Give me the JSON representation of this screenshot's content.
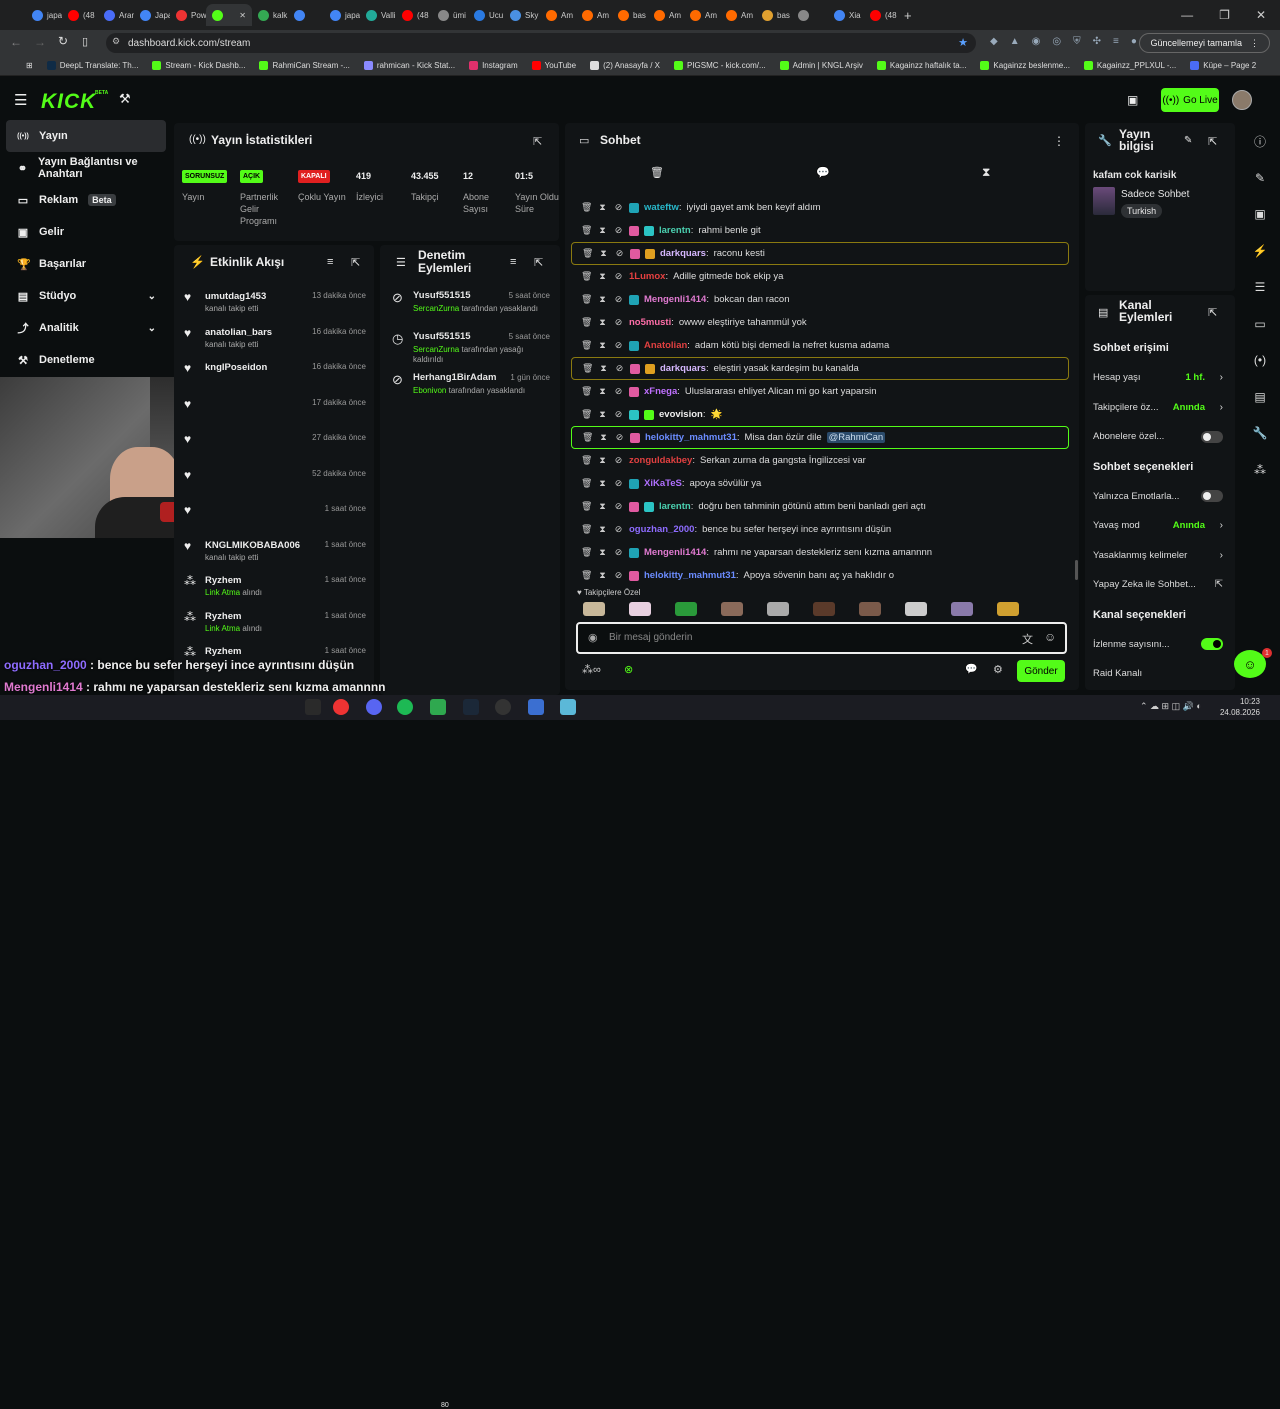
{
  "browser": {
    "tabs": [
      "japa",
      "(48",
      "Aran",
      "Japa",
      "Pow",
      "",
      "kalk",
      "",
      "japa",
      "Valli",
      "(48",
      "ümi",
      "Ucu",
      "Sky",
      "Am",
      "Am",
      "bas",
      "Am",
      "Am",
      "Am",
      "bas",
      "",
      "Xia",
      "(48"
    ],
    "url": "dashboard.kick.com/stream",
    "update_label": "Güncellemeyi tamamla",
    "bookmarks": [
      "DeepL Translate: Th...",
      "Stream - Kick Dashb...",
      "RahmiCan Stream -...",
      "rahmican - Kick Stat...",
      "Instagram",
      "YouTube",
      "(2) Anasayfa / X",
      "PIGSMC - kick.com/...",
      "Admin | KNGL Arşiv",
      "Kagainzz haftalık ta...",
      "Kagainzz beslenme...",
      "Kagainzz_PPLXUL -...",
      "Küpe – Page 2"
    ]
  },
  "nav": {
    "logo": "KICK",
    "beta": "BETA",
    "go_live": "Go Live"
  },
  "sidebar": {
    "items": [
      {
        "label": "Yayın",
        "icon": "broadcast-icon"
      },
      {
        "label": "Yayın Bağlantısı ve Anahtarı",
        "icon": "link-icon"
      },
      {
        "label": "Reklam",
        "icon": "ad-icon",
        "badge": "Beta"
      },
      {
        "label": "Gelir",
        "icon": "wallet-icon"
      },
      {
        "label": "Başarılar",
        "icon": "trophy-icon"
      },
      {
        "label": "Stüdyo",
        "icon": "studio-icon"
      },
      {
        "label": "Analitik",
        "icon": "analytics-icon"
      },
      {
        "label": "Denetleme",
        "icon": "hammer-icon"
      }
    ]
  },
  "stats": {
    "title": "Yayın İstatistikleri",
    "items": [
      {
        "value": "SORUNSUZ",
        "label": "Yayın"
      },
      {
        "value": "AÇIK",
        "label": "Partnerlik Gelir Programı"
      },
      {
        "value": "KAPALI",
        "label": "Çoklu Yayın"
      },
      {
        "value": "419",
        "label": "İzleyici"
      },
      {
        "value": "43.455",
        "label": "Takipçi"
      },
      {
        "value": "12",
        "label": "Abone Sayısı"
      },
      {
        "value": "01:5",
        "label": "Yayın Oldu Süre"
      }
    ]
  },
  "activity": {
    "title": "Etkinlik Akışı",
    "items": [
      {
        "name": "umutdag1453",
        "sub": "kanalı takip etti",
        "time": "13 dakika önce",
        "type": "follow"
      },
      {
        "name": "anatolian_bars",
        "sub": "kanalı takip etti",
        "time": "16 dakika önce",
        "type": "follow"
      },
      {
        "name": "kngIPoseidon",
        "sub": "",
        "time": "16 dakika önce",
        "type": "follow"
      },
      {
        "name": "",
        "sub": "",
        "time": "17 dakika önce",
        "type": "follow"
      },
      {
        "name": "",
        "sub": "",
        "time": "27 dakika önce",
        "type": "follow"
      },
      {
        "name": "",
        "sub": "",
        "time": "52 dakika önce",
        "type": "follow"
      },
      {
        "name": "",
        "sub": "",
        "time": "1 saat önce",
        "type": "follow"
      },
      {
        "name": "KNGLMIKOBABA006",
        "sub": "kanalı takip etti",
        "time": "1 saat önce",
        "type": "follow"
      },
      {
        "name": "Ryzhem",
        "sub_green": "Link Atma",
        "sub": "alındı",
        "time": "1 saat önce",
        "type": "reward"
      },
      {
        "name": "Ryzhem",
        "sub_green": "Link Atma",
        "sub": "alındı",
        "time": "1 saat önce",
        "type": "reward"
      },
      {
        "name": "Ryzhem",
        "sub": "",
        "time": "1 saat önce",
        "type": "reward"
      }
    ]
  },
  "moderation": {
    "title": "Denetim Eylemleri",
    "items": [
      {
        "name": "Yusuf551515",
        "by": "SercanZurna",
        "desc": "tarafından yasaklandı",
        "time": "5 saat önce",
        "icon": "ban-icon"
      },
      {
        "name": "Yusuf551515",
        "by": "SercanZurna",
        "desc": "tarafından yasağı kaldırıldı",
        "time": "5 saat önce",
        "icon": "clock-icon"
      },
      {
        "name": "Herhang1BirAdam",
        "by": "Ebonivon",
        "desc": "tarafından yasaklandı",
        "time": "1 gün önce",
        "icon": "ban-icon"
      }
    ]
  },
  "chat": {
    "title": "Sohbet",
    "messages": [
      {
        "user": "wateftw",
        "color": "#28b7c9",
        "text": "iyiydi gayet amk ben keyif aldım",
        "badges": [
          "#1fa3b5"
        ],
        "hl": ""
      },
      {
        "user": "larentn",
        "color": "#4bd0b0",
        "text": "rahmi benle git",
        "badges": [
          "#e05aa0",
          "#2bc4c4"
        ],
        "hl": ""
      },
      {
        "user": "darkquars",
        "color": "#d6b8ff",
        "text": "raconu kesti",
        "badges": [
          "#e05aa0",
          "#e0a020"
        ],
        "hl": "gold"
      },
      {
        "user": "1Lumox",
        "color": "#e64040",
        "text": "Adille gitmede bok ekip ya",
        "badges": [],
        "hl": ""
      },
      {
        "user": "Mengenli1414",
        "color": "#e07ad0",
        "text": "bokcan dan racon",
        "badges": [
          "#1fa3b5"
        ],
        "hl": ""
      },
      {
        "user": "no5musti",
        "color": "#ff6ea8",
        "text": "owww eleştiriye tahammül yok",
        "badges": [],
        "hl": ""
      },
      {
        "user": "Anatolian",
        "color": "#e04040",
        "text": "adam kötü bişi demedi la nefret kusma adama",
        "badges": [
          "#1fa3b5"
        ],
        "hl": ""
      },
      {
        "user": "darkquars",
        "color": "#d6b8ff",
        "text": "eleştiri yasak kardeşim bu kanalda",
        "badges": [
          "#e05aa0",
          "#e0a020"
        ],
        "hl": "gold"
      },
      {
        "user": "xFnega",
        "color": "#c070ff",
        "text": "Uluslararası ehliyet Alican mi go kart yaparsin",
        "badges": [
          "#e05aa0"
        ],
        "hl": ""
      },
      {
        "user": "evovision",
        "color": "#eeeeee",
        "text": "🌟",
        "badges": [
          "#2bc4c4",
          "#53fc18"
        ],
        "hl": ""
      },
      {
        "user": "helokitty_mahmut31",
        "color": "#6b8cff",
        "text": "Misa dan özür dile",
        "mention": "@RahmiCan",
        "badges": [
          "#e05aa0"
        ],
        "hl": "green"
      },
      {
        "user": "zonguldakbey",
        "color": "#e04040",
        "text": "Serkan zurna da gangsta İngilizcesi var",
        "badges": [],
        "hl": ""
      },
      {
        "user": "XiKaTeS",
        "color": "#b070ff",
        "text": "apoya sövülür ya",
        "badges": [
          "#1fa3b5"
        ],
        "hl": ""
      },
      {
        "user": "larentn",
        "color": "#4bd0b0",
        "text": "doğru ben tahminin götünü attım beni banladı geri açtı",
        "badges": [
          "#e05aa0",
          "#2bc4c4"
        ],
        "hl": ""
      },
      {
        "user": "oguzhan_2000",
        "color": "#8e6cff",
        "text": "bence bu sefer herşeyi ince ayrıntısını düşün",
        "badges": [],
        "hl": ""
      },
      {
        "user": "Mengenli1414",
        "color": "#e07ad0",
        "text": "rahmı ne yaparsan destekleriz senı kızma amannnn",
        "badges": [
          "#1fa3b5"
        ],
        "hl": ""
      },
      {
        "user": "helokitty_mahmut31",
        "color": "#6b8cff",
        "text": "Apoya sövenin banı aç ya haklıdır o",
        "badges": [
          "#e05aa0"
        ],
        "hl": ""
      }
    ],
    "emote_section": "Takipçilere Özel",
    "input_placeholder": "Bir mesaj gönderin",
    "send_label": "Gönder"
  },
  "stream_info": {
    "title": "Yayın bilgisi",
    "stream_title": "kafam cok karisik",
    "category": "Sadece Sohbet",
    "tag": "Turkish"
  },
  "channel_actions": {
    "title": "Kanal Eylemleri",
    "chat_access": "Sohbet erişimi",
    "account_age": {
      "label": "Hesap yaşı",
      "value": "1 hf."
    },
    "followers_only": {
      "label": "Takipçilere öz...",
      "value": "Anında"
    },
    "subs_only": {
      "label": "Abonelere özel...",
      "on": false
    },
    "chat_options": "Sohbet seçenekleri",
    "emote_only": {
      "label": "Yalnızca Emotlarla...",
      "on": false
    },
    "slow_mode": {
      "label": "Yavaş mod",
      "value": "Anında"
    },
    "banned_words": "Yasaklanmış kelimeler",
    "ai_chat": "Yapay Zeka ile Sohbet...",
    "channel_options": "Kanal seçenekleri",
    "view_count": {
      "label": "İzlenme sayısını...",
      "on": true
    },
    "raid": "Raid Kanalı"
  },
  "overlay": {
    "lines": [
      {
        "user": "oguzhan_2000",
        "text": "bence bu sefer herşeyi ince ayrıntısını düşün",
        "color": "#8e6cff"
      },
      {
        "user": "Mengenli1414",
        "text": "rahmı ne yaparsan destekleriz senı kızma amannnn",
        "color": "#e07ad0"
      },
      {
        "user": "helokitty_mahmut31",
        "text": "Apoya sövenin banı aç ya haklıdır o",
        "color": "#6b8cff"
      }
    ]
  },
  "taskbar": {
    "time": "10:23",
    "date": "24.08.2026",
    "badge": "80",
    "notif": "1"
  },
  "colors": {
    "brand": "#53fc18",
    "bg": "#0b0e0f",
    "panel": "#111416"
  }
}
